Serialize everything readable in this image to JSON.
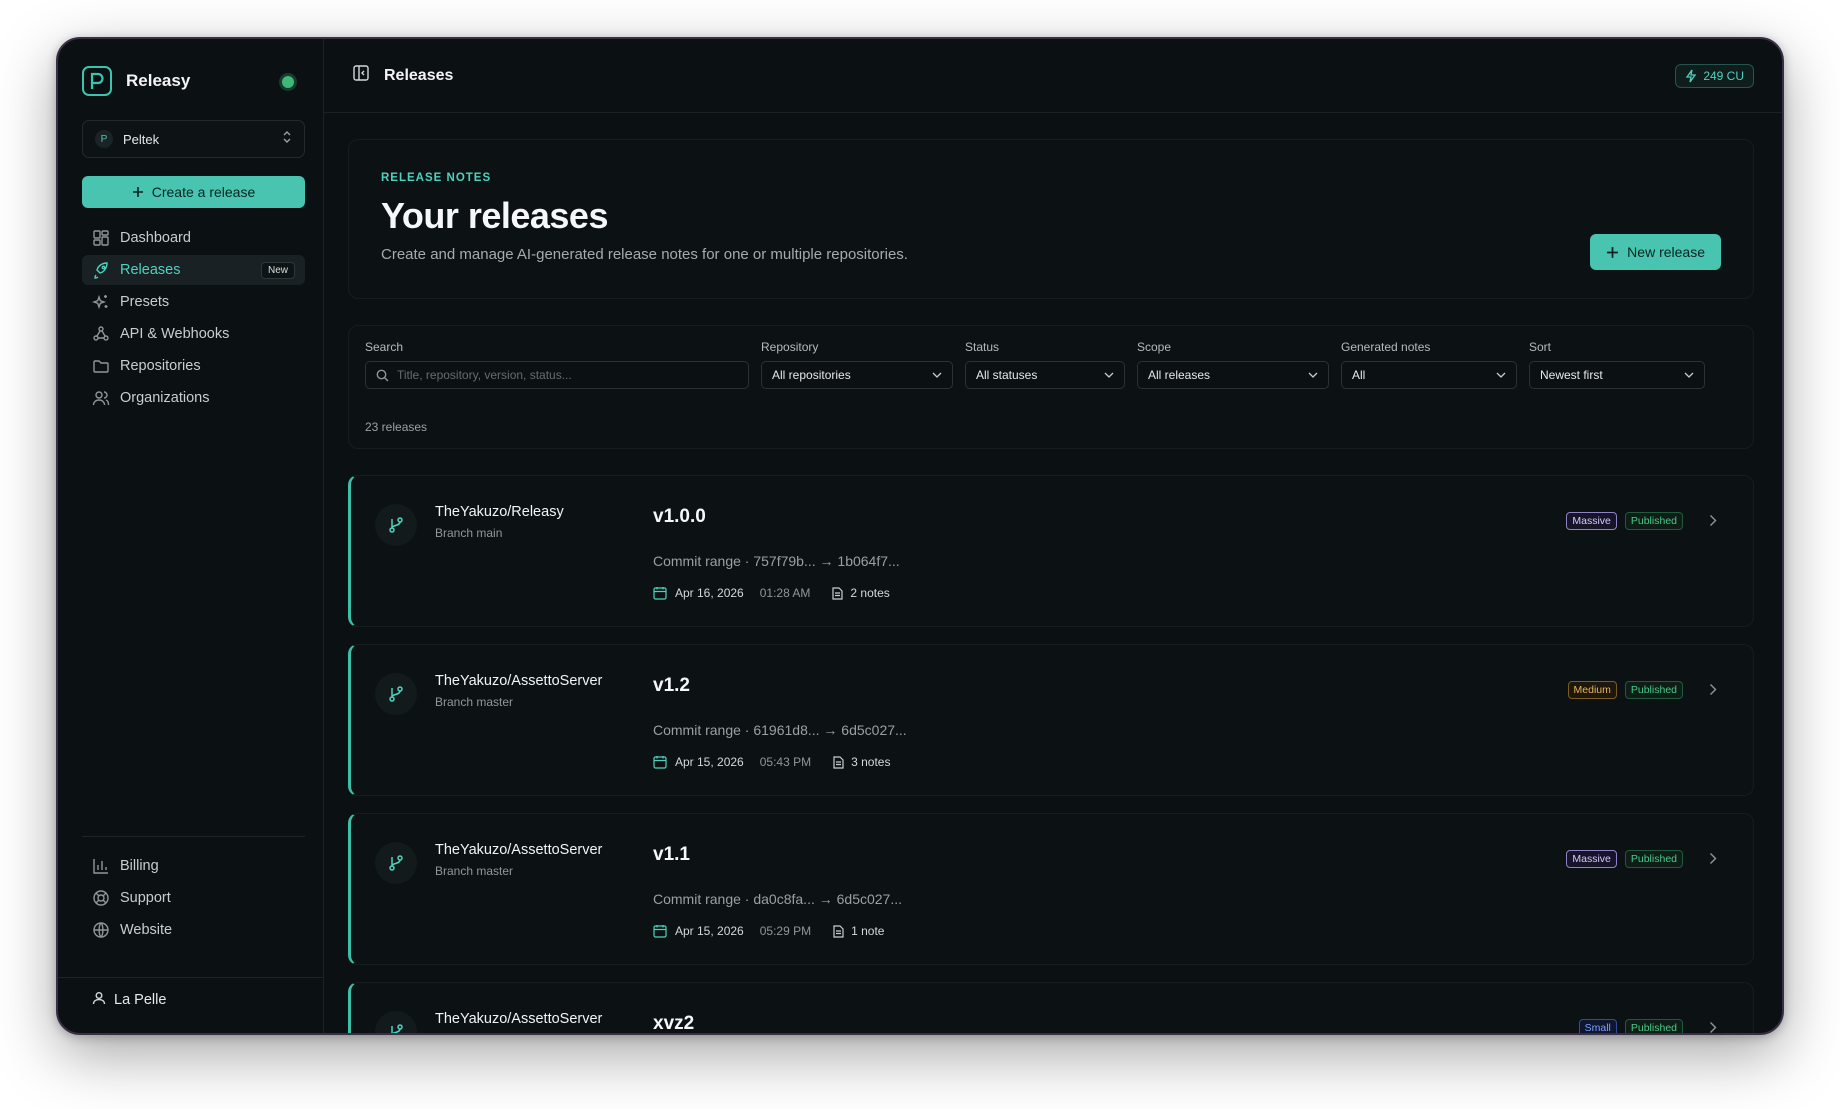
{
  "app": {
    "name": "Releasy"
  },
  "sidebar": {
    "org": {
      "initial": "P",
      "name": "Peltek"
    },
    "create_label": "Create a release",
    "items": [
      {
        "label": "Dashboard",
        "icon": "dashboard-icon"
      },
      {
        "label": "Releases",
        "icon": "rocket-icon",
        "badge": "New",
        "active": true
      },
      {
        "label": "Presets",
        "icon": "sparkles-icon"
      },
      {
        "label": "API & Webhooks",
        "icon": "webhook-icon"
      },
      {
        "label": "Repositories",
        "icon": "folder-icon"
      },
      {
        "label": "Organizations",
        "icon": "users-icon"
      }
    ],
    "bottom_items": [
      {
        "label": "Billing",
        "icon": "bar-chart-icon"
      },
      {
        "label": "Support",
        "icon": "lifebuoy-icon"
      },
      {
        "label": "Website",
        "icon": "globe-icon"
      }
    ],
    "user": "La Pelle"
  },
  "topbar": {
    "title": "Releases",
    "credits": "249 CU"
  },
  "hero": {
    "eyebrow": "RELEASE NOTES",
    "title": "Your releases",
    "subtitle": "Create and manage AI-generated release notes for one or multiple repositories.",
    "new_label": "New release"
  },
  "filters": {
    "search_label": "Search",
    "search_placeholder": "Title, repository, version, status...",
    "repository_label": "Repository",
    "repository_value": "All repositories",
    "status_label": "Status",
    "status_value": "All statuses",
    "scope_label": "Scope",
    "scope_value": "All releases",
    "generated_label": "Generated notes",
    "generated_value": "All",
    "sort_label": "Sort",
    "sort_value": "Newest first",
    "count": "23 releases"
  },
  "releases": [
    {
      "repo": "TheYakuzo/Releasy",
      "branch": "Branch main",
      "version": "v1.0.0",
      "commit": "Commit range · 757f79b... → 1b064f7...",
      "date": "Apr 16, 2026",
      "time": "01:28 AM",
      "notes": "2 notes",
      "size": "Massive",
      "status": "Published"
    },
    {
      "repo": "TheYakuzo/AssettoServer",
      "branch": "Branch master",
      "version": "v1.2",
      "commit": "Commit range · 61961d8... → 6d5c027...",
      "date": "Apr 15, 2026",
      "time": "05:43 PM",
      "notes": "3 notes",
      "size": "Medium",
      "status": "Published"
    },
    {
      "repo": "TheYakuzo/AssettoServer",
      "branch": "Branch master",
      "version": "v1.1",
      "commit": "Commit range · da0c8fa... → 6d5c027...",
      "date": "Apr 15, 2026",
      "time": "05:29 PM",
      "notes": "1 note",
      "size": "Massive",
      "status": "Published"
    },
    {
      "repo": "TheYakuzo/AssettoServer",
      "branch": "",
      "version": "xvz2",
      "commit": "",
      "date": "",
      "time": "",
      "notes": "",
      "size": "Small",
      "status": "Published"
    }
  ],
  "colors": {
    "accent": "#48c4b1",
    "background": "#0b1012",
    "published": "#48c98b",
    "massive": "#d7c9ff",
    "medium": "#e6b45a",
    "small": "#7aa2ff"
  }
}
